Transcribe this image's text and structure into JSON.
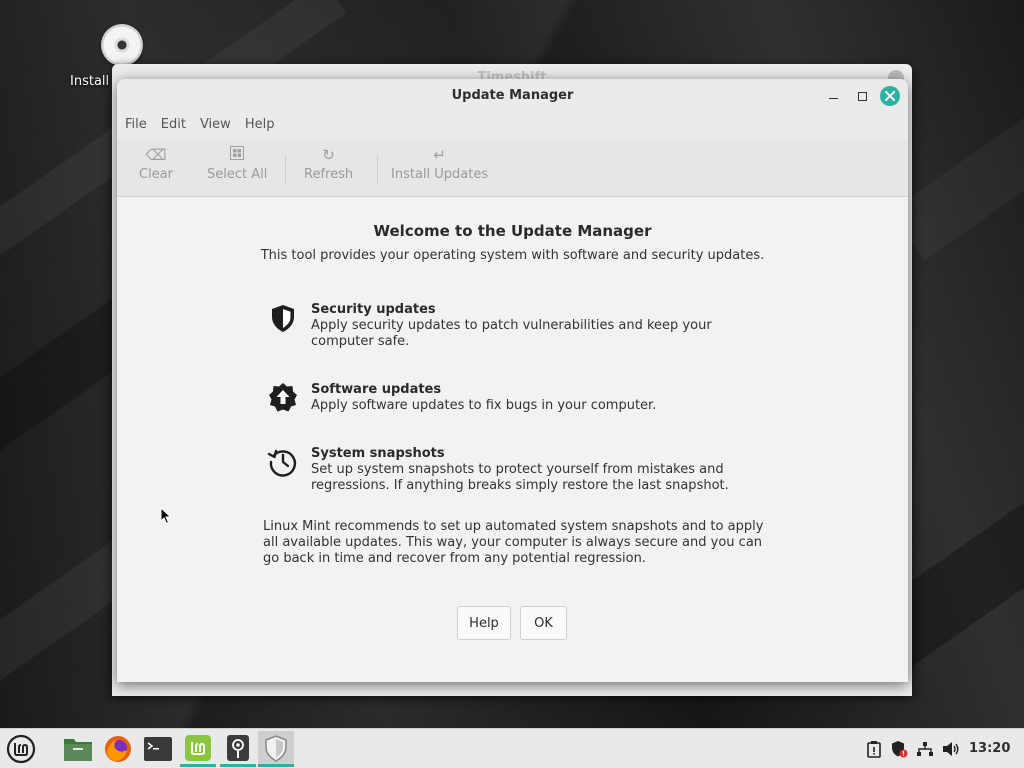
{
  "desktop": {
    "icon_label": "Install"
  },
  "background_window": {
    "title": "Timeshift"
  },
  "window": {
    "title": "Update Manager"
  },
  "menubar": {
    "items": [
      "File",
      "Edit",
      "View",
      "Help"
    ]
  },
  "toolbar": {
    "clear": "Clear",
    "select_all": "Select All",
    "refresh": "Refresh",
    "install_updates": "Install Updates"
  },
  "welcome": {
    "title": "Welcome to the Update Manager",
    "subtitle": "This tool provides your operating system with software and security updates.",
    "features": [
      {
        "icon": "shield-icon",
        "title": "Security updates",
        "description": "Apply security updates to patch vulnerabilities and keep your computer safe."
      },
      {
        "icon": "upload-badge-icon",
        "title": "Software updates",
        "description": "Apply software updates to fix bugs in your computer."
      },
      {
        "icon": "history-clock-icon",
        "title": "System snapshots",
        "description": "Set up system snapshots to protect yourself from mistakes and regressions. If anything breaks simply restore the last snapshot."
      }
    ],
    "note": "Linux Mint recommends to set up automated system snapshots and to apply all available updates. This way, your computer is always secure and you can go back in time and recover from any potential regression.",
    "help_button": "Help",
    "ok_button": "OK"
  },
  "taskbar": {
    "apps": [
      "mint-menu-icon",
      "files-icon",
      "firefox-icon",
      "terminal-icon",
      "mintinstall-icon",
      "timeshift-icon",
      "update-manager-icon"
    ],
    "clock": "13:20"
  },
  "colors": {
    "accent": "#2fb0a5",
    "firefox": "#e66000"
  }
}
